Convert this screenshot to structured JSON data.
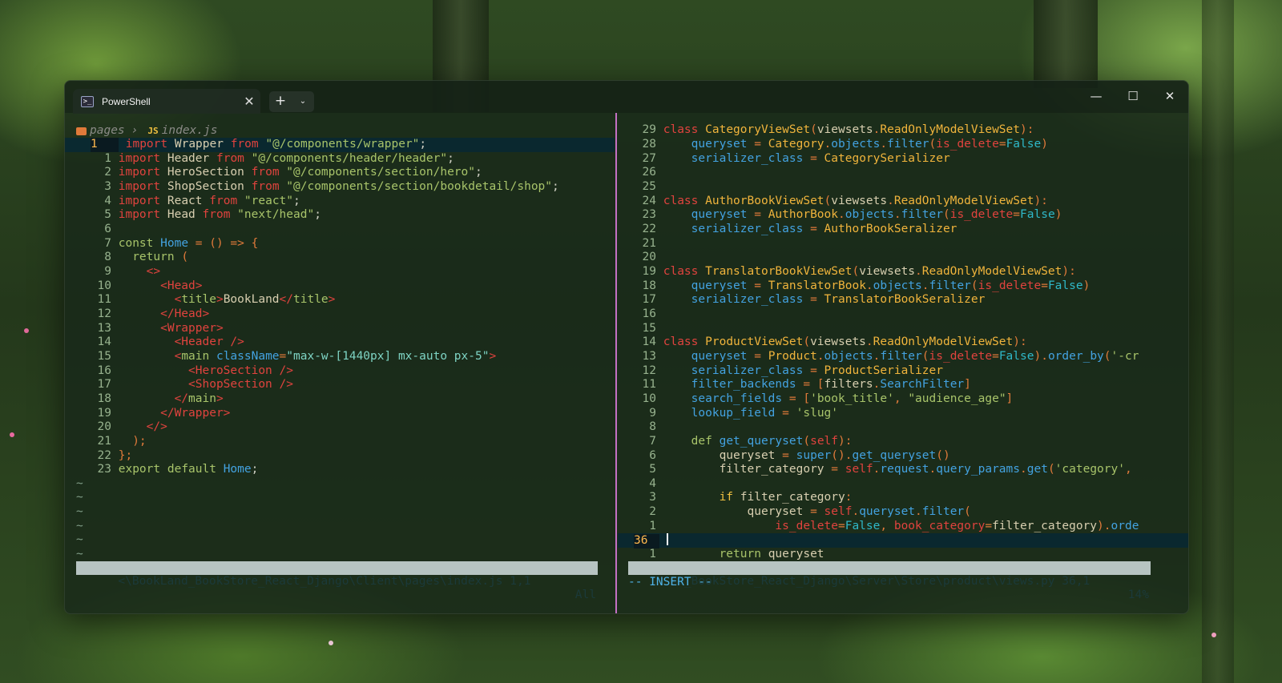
{
  "window": {
    "tab_title": "PowerShell",
    "tab_icon": "powershell-icon",
    "new_tab_glyph": "+",
    "dropdown_glyph": "⌄",
    "close_glyph": "✕",
    "controls": {
      "minimize": "—",
      "maximize": "☐",
      "close": "✕"
    }
  },
  "left_pane": {
    "breadcrumb": {
      "folder": "pages",
      "file": "index.js",
      "file_icon_label": "JS"
    },
    "status_path": "<\\BookLand_BookStore_React_Django\\Client\\pages\\index.js 1,1",
    "status_pos": "All"
  },
  "right_pane": {
    "status_path": "<d_BookStore_React_Django\\Server\\Store\\product\\views.py 36,1",
    "status_pos": "14%",
    "mode": "-- INSERT --"
  },
  "colors": {
    "accent_divider": "#c470c4",
    "statusbar_bg": "#b7c4c2",
    "keyword_red": "#e0433e",
    "string_green": "#a8c46a",
    "function_blue": "#43a2e0",
    "class_yellow": "#f0b43c"
  }
}
